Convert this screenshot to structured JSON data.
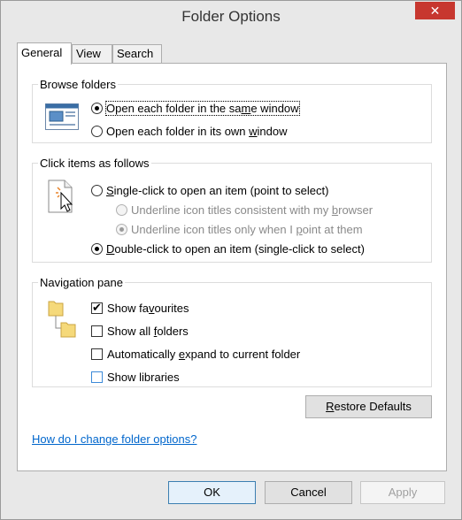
{
  "window": {
    "title": "Folder Options",
    "close_glyph": "✕"
  },
  "tabs": [
    {
      "label": "General",
      "active": true
    },
    {
      "label": "View",
      "active": false
    },
    {
      "label": "Search",
      "active": false
    }
  ],
  "browse_folders": {
    "legend": "Browse folders",
    "icon": "window-icon",
    "options": [
      {
        "pre": "Open each folder in the sa",
        "accel": "m",
        "post": "e window",
        "checked": true
      },
      {
        "pre": "Open each folder in its own ",
        "accel": "w",
        "post": "indow",
        "checked": false
      }
    ]
  },
  "click_items": {
    "legend": "Click items as follows",
    "icon": "cursor-document-icon",
    "single_click": {
      "pre": "",
      "accel": "S",
      "post": "ingle-click to open an item (point to select)",
      "checked": false
    },
    "underline_consistent": {
      "pre": "Underline icon titles consistent with my ",
      "accel": "b",
      "post": "rowser",
      "checked": false,
      "disabled": true
    },
    "underline_point": {
      "pre": "Underline icon titles only when I ",
      "accel": "p",
      "post": "oint at them",
      "checked": true,
      "disabled": true
    },
    "double_click": {
      "pre": "",
      "accel": "D",
      "post": "ouble-click to open an item (single-click to select)",
      "checked": true
    }
  },
  "navigation_pane": {
    "legend": "Navigation pane",
    "icon": "folder-tree-icon",
    "items": [
      {
        "pre": "Show fa",
        "accel": "v",
        "post": "ourites",
        "checked": true
      },
      {
        "pre": "Show all ",
        "accel": "f",
        "post": "olders",
        "checked": false
      },
      {
        "pre": "Automatically ",
        "accel": "e",
        "post": "xpand to current folder",
        "checked": false
      },
      {
        "pre": "Show libraries",
        "accel": "",
        "post": "",
        "checked": false
      }
    ]
  },
  "restore_defaults": {
    "pre": "",
    "accel": "R",
    "post": "estore Defaults"
  },
  "help_link": "How do I change folder options?",
  "buttons": {
    "ok": "OK",
    "cancel": "Cancel",
    "apply": "Apply"
  }
}
